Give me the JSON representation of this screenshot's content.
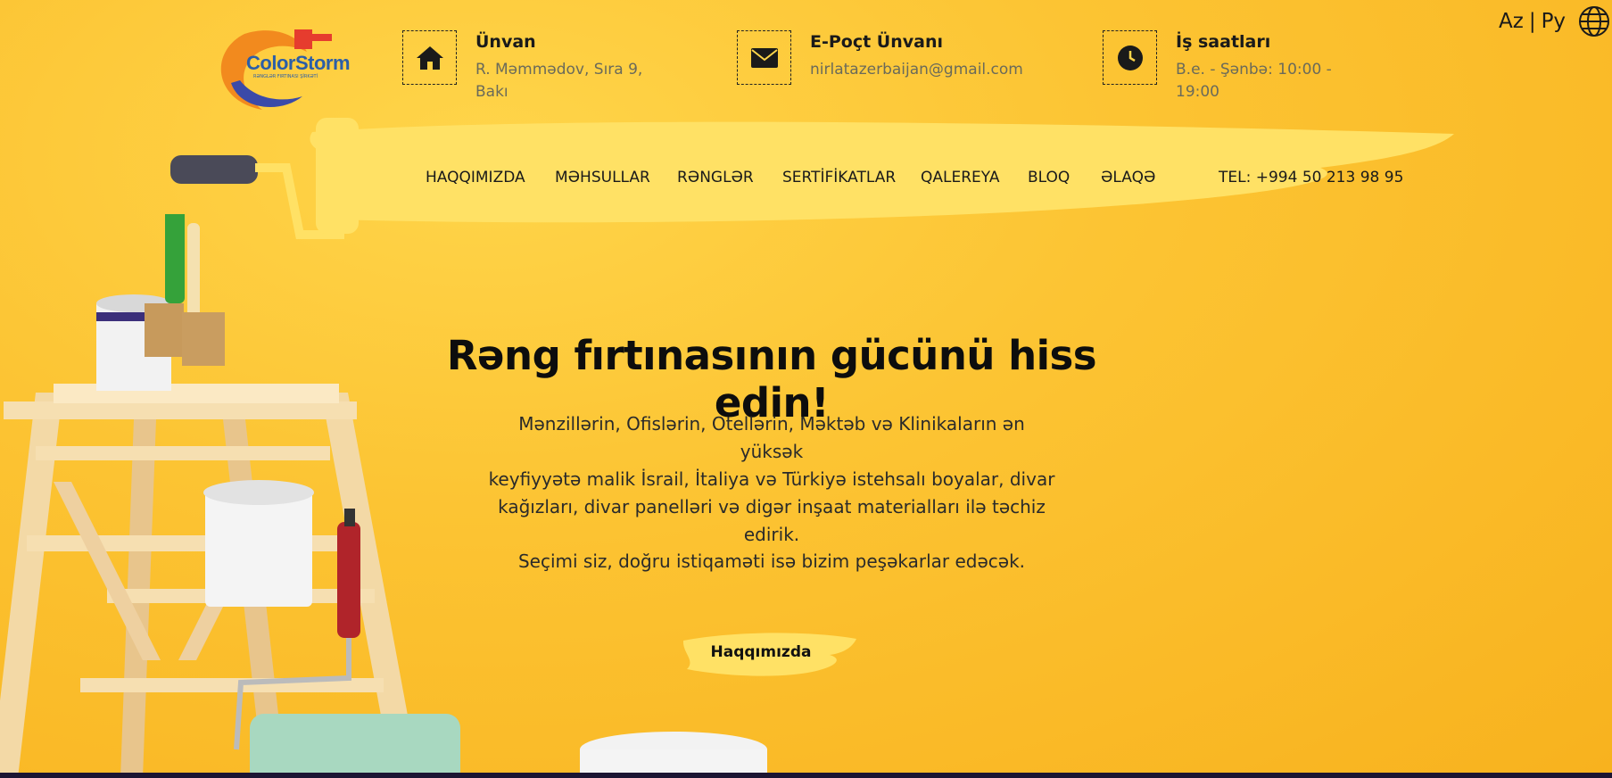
{
  "brand": {
    "name": "ColorStorm",
    "tagline": "RƏNGLƏR FIRTINASI ŞİRKƏTİ"
  },
  "contact": {
    "address": {
      "icon": "home-icon",
      "title": "Ünvan",
      "value_line1": "R. Məmmədov, Sıra 9,",
      "value_line2": "Bakı"
    },
    "email": {
      "icon": "envelope-icon",
      "title": "E-Poçt Ünvanı",
      "value": "nirlatazerbaijan@gmail.com"
    },
    "hours": {
      "icon": "clock-icon",
      "title": "İş saatları",
      "value_line1": "B.e. - Şənbə: 10:00 -",
      "value_line2": "19:00"
    }
  },
  "language": {
    "az": "Az",
    "separator": "|",
    "ru": "Ру",
    "icon": "globe-icon"
  },
  "nav": {
    "items": [
      {
        "label": "HAQQIMIZDA"
      },
      {
        "label": "MƏHSULLAR"
      },
      {
        "label": "RƏNGLƏR"
      },
      {
        "label": "SERTİFİKATLAR"
      },
      {
        "label": "QALEREYA"
      },
      {
        "label": "BLOQ"
      },
      {
        "label": "ƏLAQƏ"
      }
    ],
    "phone": "TEL: +994 50 213 98 95"
  },
  "hero": {
    "title": "Rəng fırtınasının gücünü hiss edin!",
    "text_line1": "Mənzillərin, Ofislərin, Otellərin, Məktəb və Klinikaların ən yüksək",
    "text_line2": "keyfiyyətə malik İsrail, İtaliya və Türkiyə istehsalı boyalar, divar",
    "text_line3": "kağızları, divar panelləri və digər inşaat materialları ilə təchiz",
    "text_line4": "edirik.",
    "subtext": "Seçimi siz, doğru istiqaməti isə bizim peşəkarlar edəcək.",
    "cta_label": "Haqqımızda"
  },
  "colors": {
    "background": "#fbb927",
    "brush": "#ffe165",
    "logo_blue": "#2b5ea8",
    "logo_orange": "#f28a1e",
    "text_dark": "#1a1a1a"
  }
}
